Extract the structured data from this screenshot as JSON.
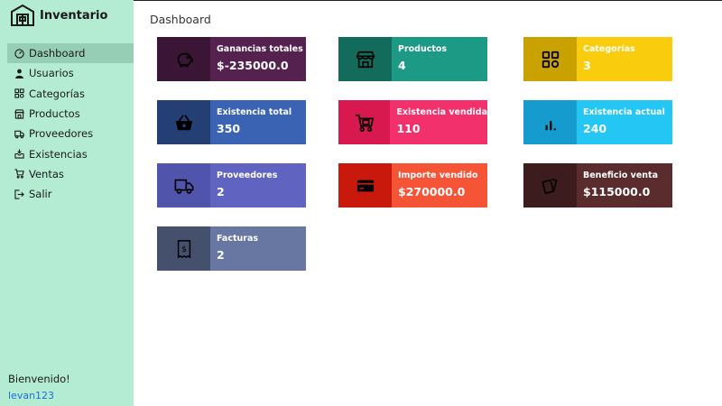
{
  "app": {
    "name": "Inventario"
  },
  "page": {
    "title": "Dashboard"
  },
  "sidebar": {
    "items": [
      {
        "label": "Dashboard",
        "icon": "dashboard-icon",
        "active": true
      },
      {
        "label": "Usuarios",
        "icon": "user-icon",
        "active": false
      },
      {
        "label": "Categorías",
        "icon": "categories-icon",
        "active": false
      },
      {
        "label": "Productos",
        "icon": "store-icon",
        "active": false
      },
      {
        "label": "Proveedores",
        "icon": "truck-icon",
        "active": false
      },
      {
        "label": "Existencias",
        "icon": "inbox-icon",
        "active": false
      },
      {
        "label": "Ventas",
        "icon": "cart-icon",
        "active": false
      },
      {
        "label": "Salir",
        "icon": "logout-icon",
        "active": false
      }
    ],
    "welcome": "Bienvenido!",
    "username": "levan123"
  },
  "cards": [
    {
      "label": "Ganancias totales",
      "value": "$-235000.0",
      "icon": "piggy-bank-icon",
      "color": "#55224f",
      "icon_bg": "#3a1536"
    },
    {
      "label": "Productos",
      "value": "4",
      "icon": "store-icon",
      "color": "#1d9a86",
      "icon_bg": "#136b5c"
    },
    {
      "label": "Categorías",
      "value": "3",
      "icon": "categories-icon",
      "color": "#f9cc0e",
      "icon_bg": "#c9a200"
    },
    {
      "label": "Existencia total",
      "value": "350",
      "icon": "basket-icon",
      "color": "#3a64b3",
      "icon_bg": "#243f73"
    },
    {
      "label": "Existencia vendida",
      "value": "110",
      "icon": "cart-icon",
      "color": "#f2306b",
      "icon_bg": "#d8194f"
    },
    {
      "label": "Existencia actual",
      "value": "240",
      "icon": "bar-chart-icon",
      "color": "#24c6f4",
      "icon_bg": "#159bce"
    },
    {
      "label": "Proveedores",
      "value": "2",
      "icon": "truck-icon",
      "color": "#6064c0",
      "icon_bg": "#5054ab"
    },
    {
      "label": "Importe vendido",
      "value": "$270000.0",
      "icon": "credit-card-icon",
      "color": "#f55436",
      "icon_bg": "#c8190c"
    },
    {
      "label": "Beneficio venta",
      "value": "$115000.0",
      "icon": "cards-icon",
      "color": "#5b2c2d",
      "icon_bg": "#3d1c1d"
    },
    {
      "label": "Facturas",
      "value": "2",
      "icon": "receipt-icon",
      "color": "#6777a2",
      "icon_bg": "#45506d"
    }
  ]
}
